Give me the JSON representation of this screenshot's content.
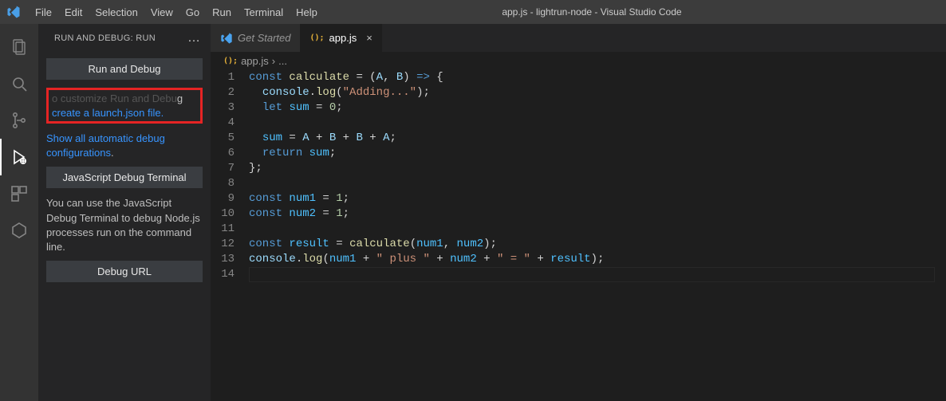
{
  "window": {
    "title": "app.js - lightrun-node - Visual Studio Code"
  },
  "menu": {
    "items": [
      "File",
      "Edit",
      "Selection",
      "View",
      "Go",
      "Run",
      "Terminal",
      "Help"
    ]
  },
  "activity_bar": {
    "items": [
      {
        "name": "explorer-icon",
        "label": "Explorer"
      },
      {
        "name": "search-icon",
        "label": "Search"
      },
      {
        "name": "scm-icon",
        "label": "Source Control"
      },
      {
        "name": "debug-icon",
        "label": "Run and Debug",
        "active": true
      },
      {
        "name": "extensions-icon",
        "label": "Extensions"
      },
      {
        "name": "hex-icon",
        "label": "Hex"
      }
    ]
  },
  "sidebar": {
    "title": "RUN AND DEBUG: RUN",
    "run_debug_btn": "Run and Debug",
    "customize_text_visible_fragment": "g",
    "create_launch_link": "create a launch.json file",
    "show_all_link": "Show all automatic debug configurations",
    "show_all_period": ".",
    "js_debug_terminal_btn": "JavaScript Debug Terminal",
    "js_debug_terminal_text": "You can use the JavaScript Debug Terminal to debug Node.js processes run on the command line.",
    "debug_url_btn": "Debug URL"
  },
  "tabs": {
    "items": [
      {
        "icon": "vscode-icon",
        "label": "Get Started",
        "active": false,
        "italic": true
      },
      {
        "icon": "js-icon",
        "label": "app.js",
        "active": true,
        "closable": true
      }
    ]
  },
  "breadcrumbs": {
    "icon": "js-icon",
    "file": "app.js",
    "sep": "›",
    "tail": "..."
  },
  "editor": {
    "line_numbers": [
      "1",
      "2",
      "3",
      "4",
      "5",
      "6",
      "7",
      "8",
      "9",
      "10",
      "11",
      "12",
      "13",
      "14"
    ],
    "current_line_index": 13
  },
  "chart_data": {
    "type": "table",
    "note": "Source code shown in editor",
    "filename": "app.js",
    "lines": [
      "const calculate = (A, B) => {",
      "  console.log(\"Adding...\");",
      "  let sum = 0;",
      "",
      "  sum = A + B + B + A;",
      "  return sum;",
      "};",
      "",
      "const num1 = 1;",
      "const num2 = 1;",
      "",
      "const result = calculate(num1, num2);",
      "console.log(num1 + \" plus \" + num2 + \" = \" + result);",
      ""
    ]
  }
}
